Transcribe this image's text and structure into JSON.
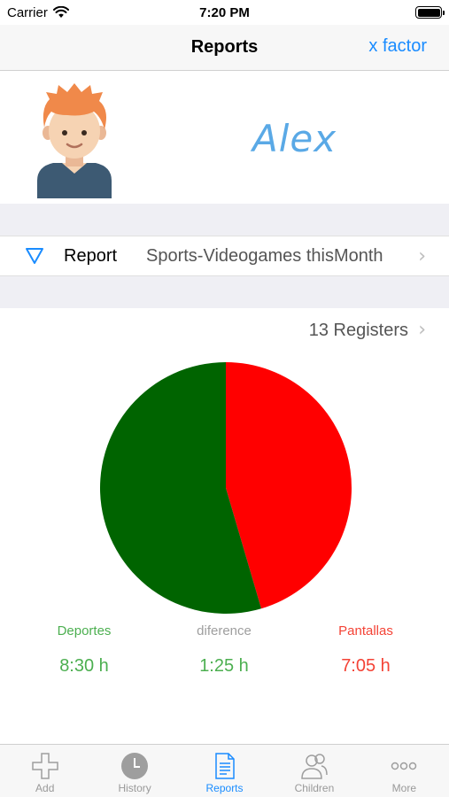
{
  "status": {
    "carrier": "Carrier",
    "time": "7:20 PM"
  },
  "nav": {
    "title": "Reports",
    "right_action": "x factor"
  },
  "profile": {
    "name": "Alex"
  },
  "report": {
    "label": "Report",
    "value": "Sports-Videogames thisMonth"
  },
  "registers": {
    "text": "13 Registers"
  },
  "chart_data": {
    "type": "pie",
    "slices": [
      {
        "label": "Deportes",
        "value": 510,
        "color": "#006400"
      },
      {
        "label": "Pantallas",
        "value": 425,
        "color": "#ff0000"
      }
    ]
  },
  "stats": {
    "deportes": {
      "label": "Deportes",
      "value": "8:30 h",
      "color": "#4caf50"
    },
    "diference": {
      "label": "diference",
      "value": "1:25 h",
      "label_color": "#9e9e9e",
      "value_color": "#4caf50"
    },
    "pantallas": {
      "label": "Pantallas",
      "value": "7:05 h",
      "color": "#f44336"
    }
  },
  "tabs": [
    {
      "label": "Add",
      "icon": "plus-icon"
    },
    {
      "label": "History",
      "icon": "clock-icon"
    },
    {
      "label": "Reports",
      "icon": "document-icon"
    },
    {
      "label": "Children",
      "icon": "people-icon"
    },
    {
      "label": "More",
      "icon": "more-icon"
    }
  ],
  "colors": {
    "accent": "#1a8cff",
    "background": "#efeff4"
  }
}
